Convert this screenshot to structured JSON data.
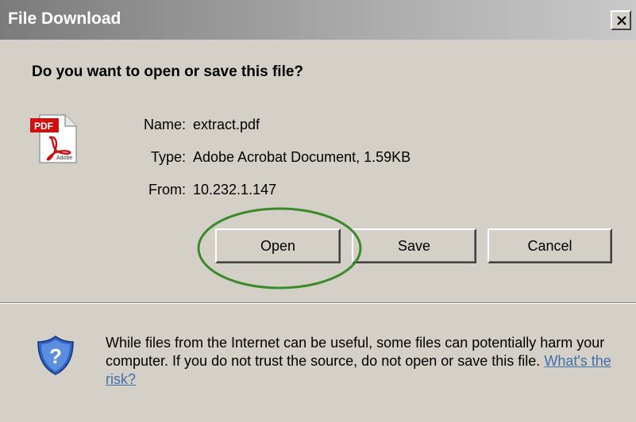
{
  "window": {
    "title": "File Download"
  },
  "dialog": {
    "question": "Do you want to open or save this file?",
    "file": {
      "icon": "pdf-file-icon",
      "name_label": "Name:",
      "name_value": "extract.pdf",
      "type_label": "Type:",
      "type_value": "Adobe Acrobat Document, 1.59KB",
      "from_label": "From:",
      "from_value": "10.232.1.147"
    },
    "buttons": {
      "open": "Open",
      "save": "Save",
      "cancel": "Cancel"
    },
    "warning": {
      "icon": "shield-question-icon",
      "text": "While files from the Internet can be useful, some files can potentially harm your computer. If you do not trust the source, do not open or save this file.",
      "link": "What's the risk?"
    }
  },
  "colors": {
    "dialog_bg": "#d4d0c8",
    "highlight_ellipse": "#3a8a2a",
    "link": "#3d6fa8"
  }
}
